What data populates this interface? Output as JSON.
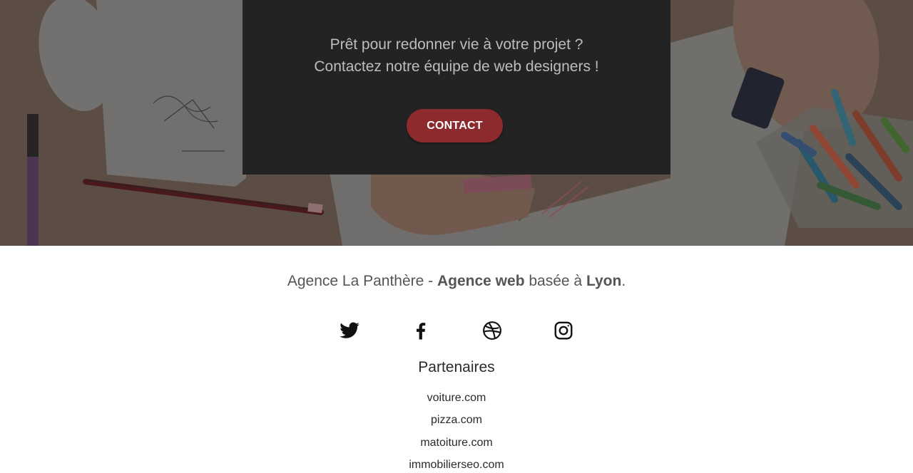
{
  "hero": {
    "line1": "Prêt pour redonner vie à votre projet ?",
    "line2": "Contactez notre équipe de web designers !",
    "contact_label": "CONTACT"
  },
  "footer": {
    "tagline": {
      "part1": "Agence La Panthère - ",
      "bold1": "Agence web",
      "part2": " basée à ",
      "bold2": "Lyon",
      "part3": "."
    },
    "social": [
      {
        "icon": "twitter-icon"
      },
      {
        "icon": "facebook-icon"
      },
      {
        "icon": "dribbble-icon"
      },
      {
        "icon": "instagram-icon"
      }
    ],
    "partners_title": "Partenaires",
    "partners": [
      "voiture.com",
      "pizza.com",
      "matoiture.com",
      "immobilierseo.com"
    ]
  },
  "colors": {
    "cta_panel": "#232323",
    "button": "#8c2a2d",
    "text_muted": "#555555"
  }
}
